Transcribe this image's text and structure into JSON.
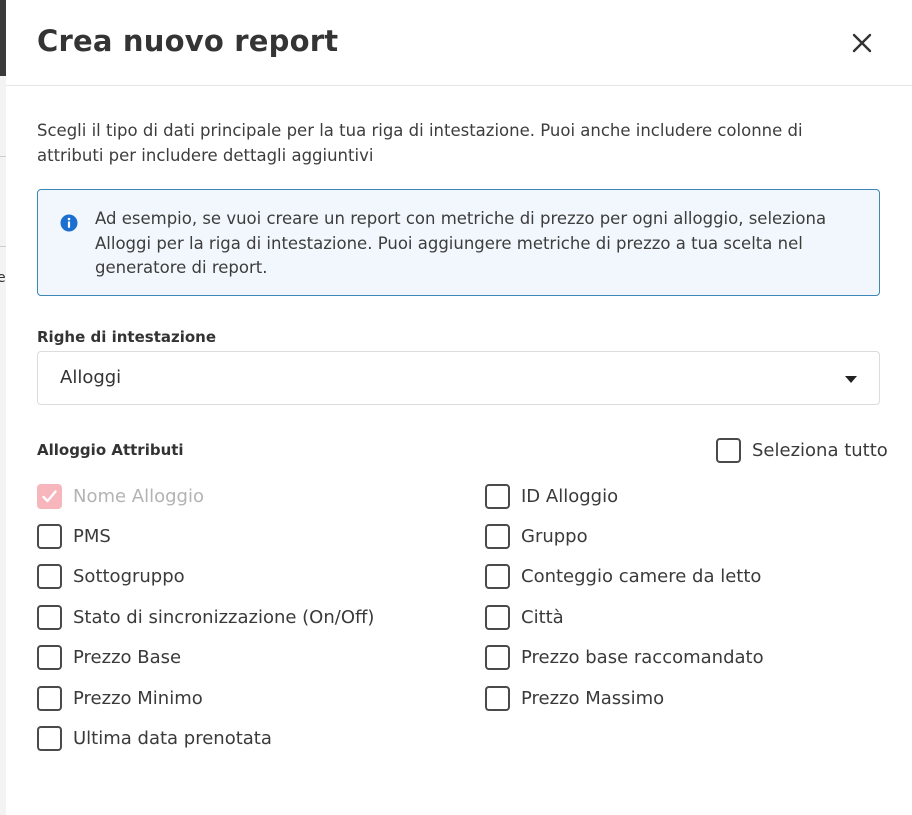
{
  "background": {
    "edge_chars": [
      "e",
      "i",
      "i",
      "i",
      "i"
    ]
  },
  "dialog": {
    "title": "Crea nuovo report",
    "close_icon": "close-icon",
    "intro": "Scegli il tipo di dati principale per la tua riga di intestazione. Puoi anche includere colonne di attributi per includere dettagli aggiuntivi",
    "info": {
      "icon": "info-icon",
      "text": "Ad esempio, se vuoi creare un report con metriche di prezzo per ogni alloggio, seleziona Alloggi per la riga di intestazione. Puoi aggiungere metriche di prezzo a tua scelta nel generatore di report."
    },
    "header_rows": {
      "label": "Righe di intestazione",
      "selected": "Alloggi"
    },
    "attributes": {
      "title": "Alloggio Attributi",
      "select_all": {
        "label": "Seleziona tutto",
        "checked": false
      },
      "items": [
        {
          "label": "Nome Alloggio",
          "checked": true,
          "disabled": true
        },
        {
          "label": "ID Alloggio",
          "checked": false,
          "disabled": false
        },
        {
          "label": "PMS",
          "checked": false,
          "disabled": false
        },
        {
          "label": "Gruppo",
          "checked": false,
          "disabled": false
        },
        {
          "label": "Sottogruppo",
          "checked": false,
          "disabled": false
        },
        {
          "label": "Conteggio camere da letto",
          "checked": false,
          "disabled": false
        },
        {
          "label": "Stato di sincronizzazione (On/Off)",
          "checked": false,
          "disabled": false
        },
        {
          "label": "Città",
          "checked": false,
          "disabled": false
        },
        {
          "label": "Prezzo Base",
          "checked": false,
          "disabled": false
        },
        {
          "label": "Prezzo base raccomandato",
          "checked": false,
          "disabled": false
        },
        {
          "label": "Prezzo Minimo",
          "checked": false,
          "disabled": false
        },
        {
          "label": "Prezzo Massimo",
          "checked": false,
          "disabled": false
        },
        {
          "label": "Ultima data prenotata",
          "checked": false,
          "disabled": false
        }
      ]
    },
    "colors": {
      "info_border": "#3d86b8",
      "info_background": "#f1f7fc",
      "info_icon": "#1a6fd0",
      "checked_disabled": "#f7b5bc"
    }
  }
}
